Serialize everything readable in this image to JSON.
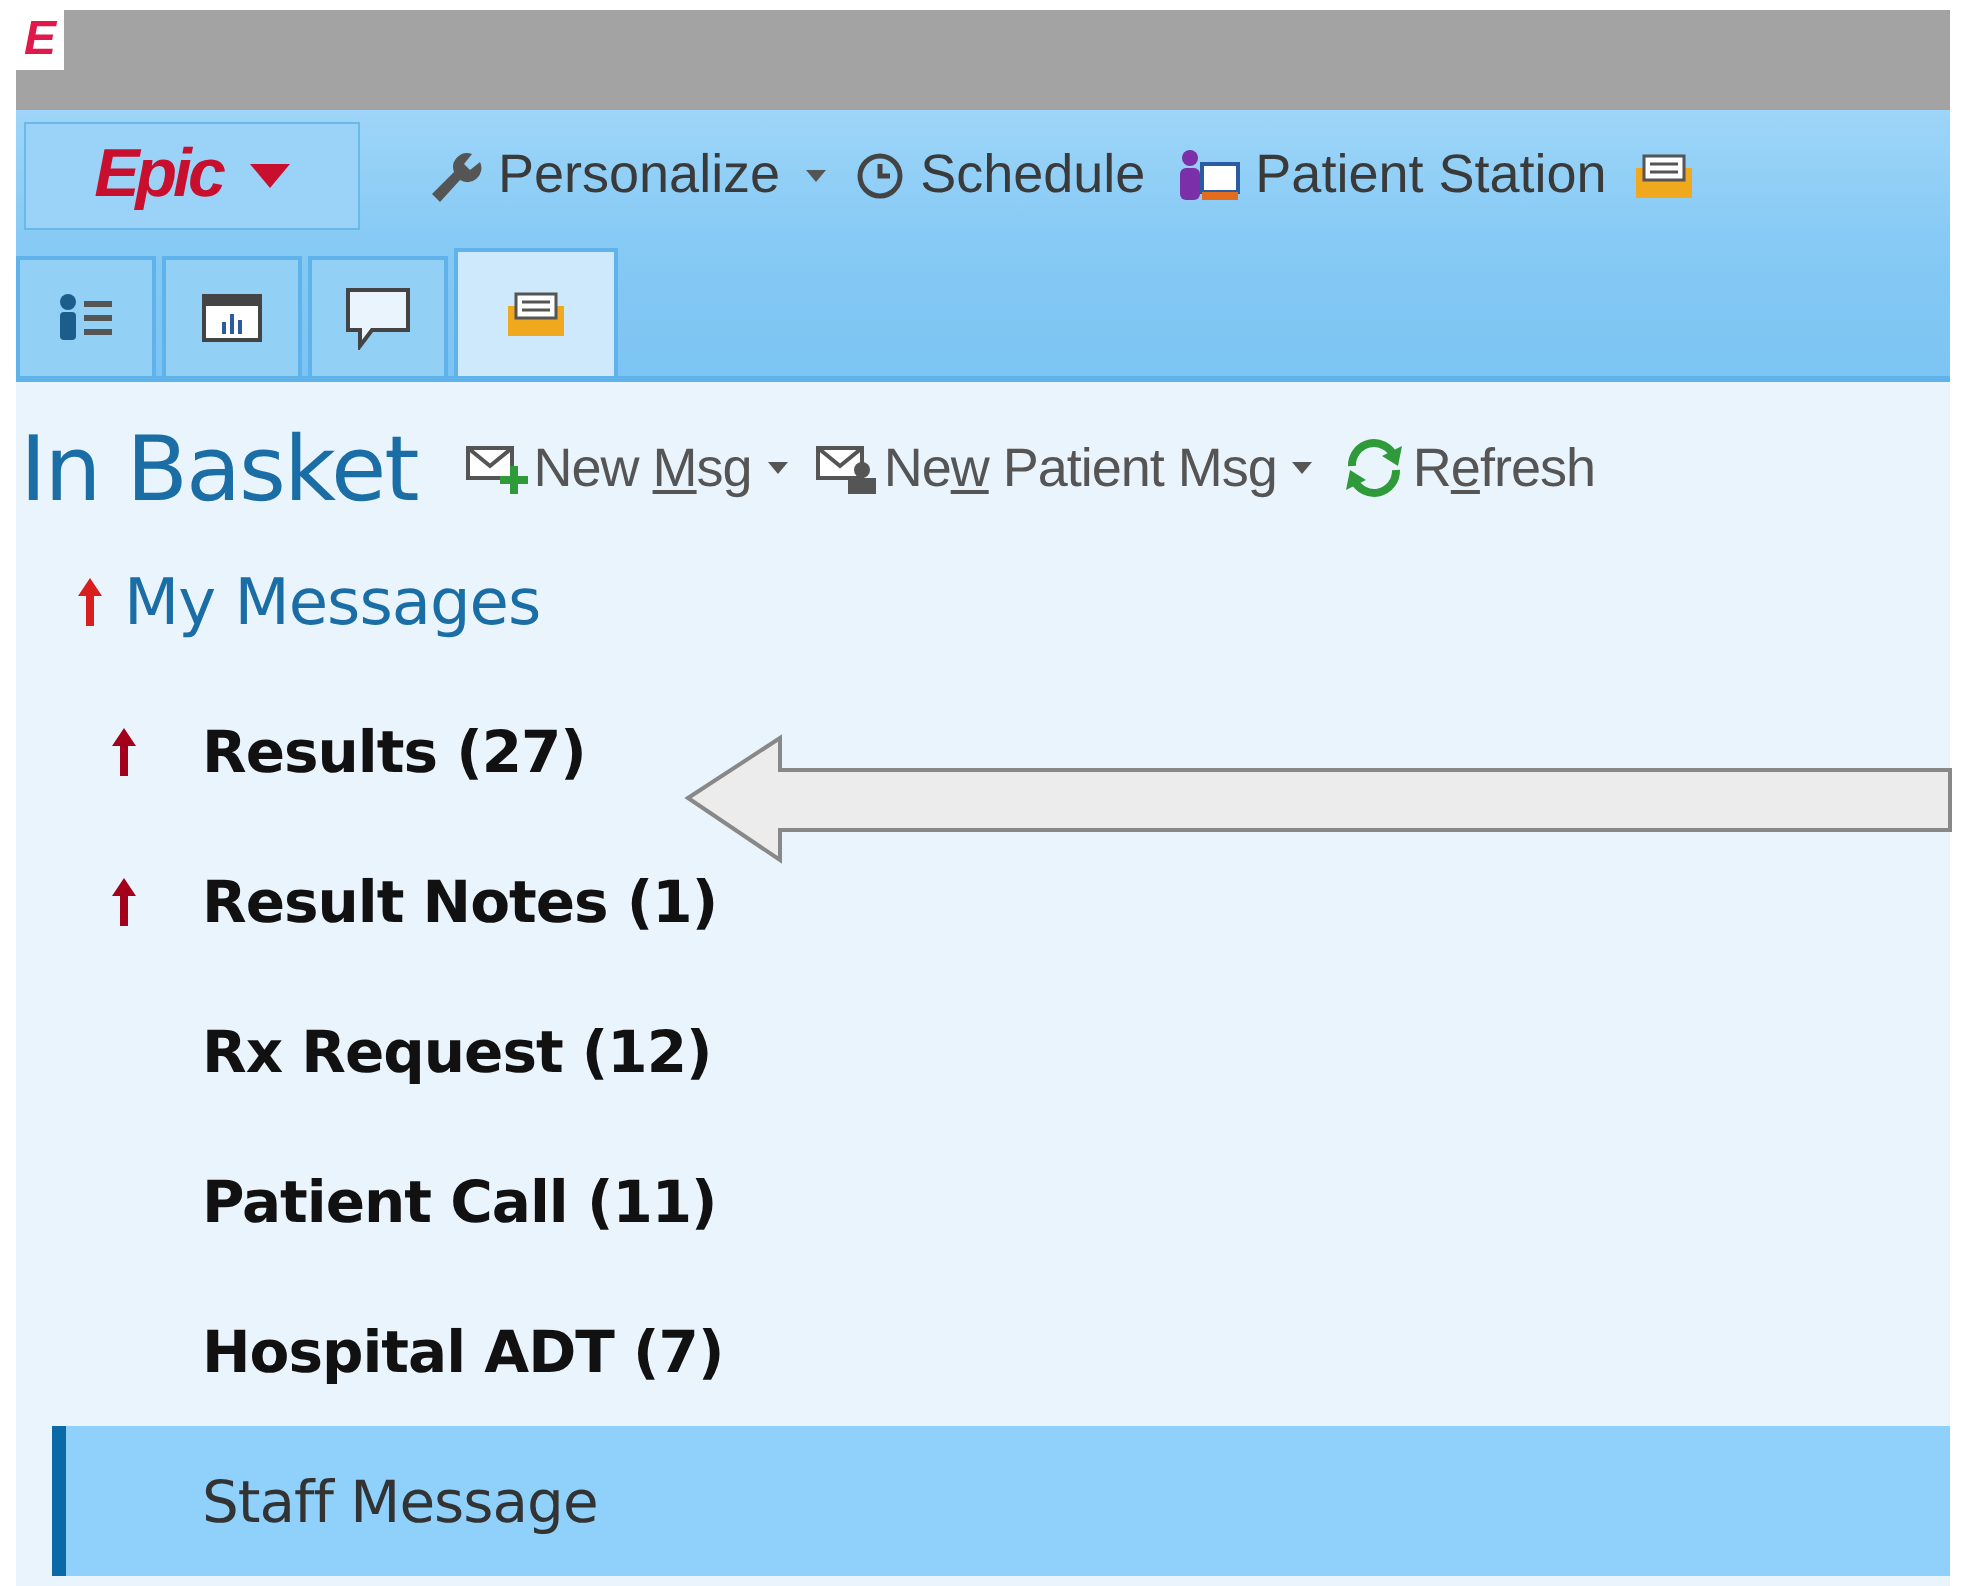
{
  "app_logo": "E",
  "toolbar": {
    "menu_button": "Epic",
    "items": [
      {
        "kind": "menu",
        "label": "Personalize"
      },
      {
        "kind": "plain",
        "label": "Schedule"
      },
      {
        "kind": "plain",
        "label": "Patient Station"
      },
      {
        "kind": "cut"
      }
    ]
  },
  "tabs": [
    {
      "selected": false
    },
    {
      "selected": false
    },
    {
      "selected": false
    },
    {
      "selected": true
    }
  ],
  "in_basket": {
    "title": "In Basket",
    "actions": [
      {
        "before": "New ",
        "mnemonic": "M",
        "after": "sg",
        "dropdown": true
      },
      {
        "before": "Ne",
        "mnemonic": "w",
        "after": " Patient Msg",
        "dropdown": true
      },
      {
        "before": "R",
        "mnemonic": "e",
        "after": "fresh",
        "dropdown": false
      }
    ]
  },
  "folder": {
    "title": "My Messages",
    "high_priority": true
  },
  "items": [
    {
      "label": "Results (27)",
      "high_priority": true,
      "unread": true,
      "selected": false
    },
    {
      "label": "Result Notes (1)",
      "high_priority": true,
      "unread": true,
      "selected": false
    },
    {
      "label": "Rx Request (12)",
      "high_priority": false,
      "unread": true,
      "selected": false
    },
    {
      "label": "Patient Call (11)",
      "high_priority": false,
      "unread": true,
      "selected": false
    },
    {
      "label": "Hospital ADT (7)",
      "high_priority": false,
      "unread": true,
      "selected": false
    },
    {
      "label": "Staff Message",
      "high_priority": false,
      "unread": false,
      "selected": true
    }
  ],
  "annotation": {
    "kind": "arrow"
  }
}
